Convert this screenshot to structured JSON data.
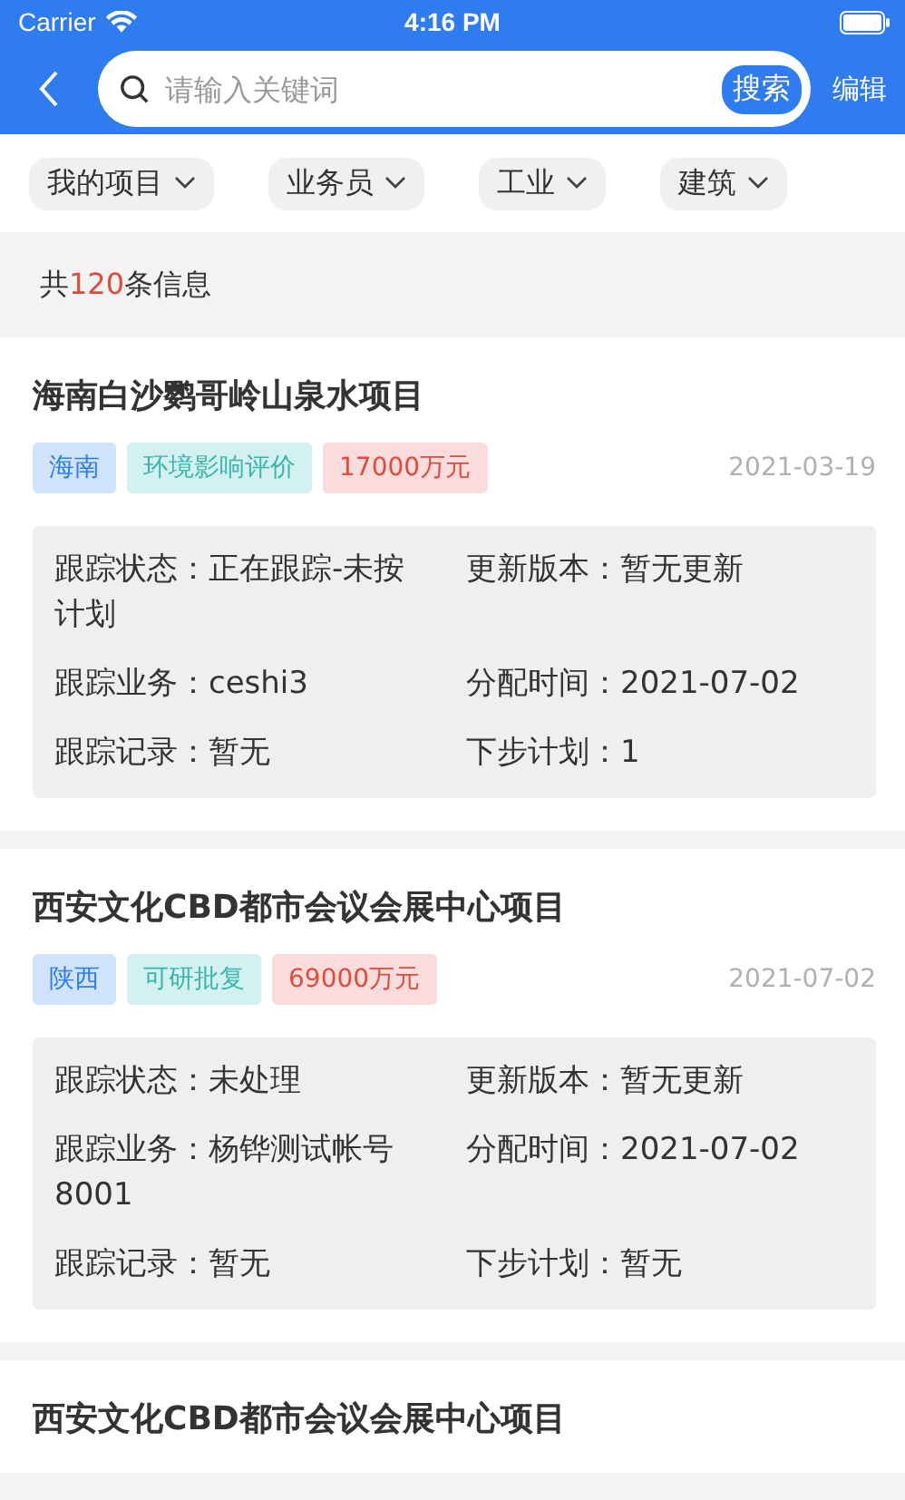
{
  "status_bar": {
    "carrier": "Carrier",
    "time": "4:16 PM"
  },
  "nav": {
    "search_placeholder": "请输入关键词",
    "search_button": "搜索",
    "edit": "编辑"
  },
  "filters": [
    {
      "label": "我的项目"
    },
    {
      "label": "业务员"
    },
    {
      "label": "工业"
    },
    {
      "label": "建筑"
    }
  ],
  "count": {
    "before": "共",
    "number": "120",
    "after": "条信息"
  },
  "projects": [
    {
      "title": "海南白沙鹦哥岭山泉水项目",
      "date": "2021-03-19",
      "tags": [
        {
          "kind": "region",
          "text": "海南"
        },
        {
          "kind": "stage",
          "text": "环境影响评价"
        },
        {
          "kind": "amount",
          "text": "17000万元"
        }
      ],
      "fields": [
        {
          "label": "跟踪状态：",
          "value": "正在跟踪-未按计划"
        },
        {
          "label": "更新版本：",
          "value": "暂无更新"
        },
        {
          "label": "跟踪业务：",
          "value": "ceshi3"
        },
        {
          "label": "分配时间：",
          "value": "2021-07-02"
        },
        {
          "label": "跟踪记录：",
          "value": "暂无"
        },
        {
          "label": "下步计划：",
          "value": "1"
        }
      ]
    },
    {
      "title": "西安文化CBD都市会议会展中心项目",
      "date": "2021-07-02",
      "tags": [
        {
          "kind": "region",
          "text": "陕西"
        },
        {
          "kind": "stage",
          "text": "可研批复"
        },
        {
          "kind": "amount",
          "text": "69000万元"
        }
      ],
      "fields": [
        {
          "label": "跟踪状态：",
          "value": "未处理"
        },
        {
          "label": "更新版本：",
          "value": "暂无更新"
        },
        {
          "label": "跟踪业务：",
          "value": "杨铧测试帐号8001"
        },
        {
          "label": "分配时间：",
          "value": "2021-07-02"
        },
        {
          "label": "跟踪记录：",
          "value": "暂无"
        },
        {
          "label": "下步计划：",
          "value": "暂无"
        }
      ]
    },
    {
      "title": "西安文化CBD都市会议会展中心项目"
    }
  ]
}
